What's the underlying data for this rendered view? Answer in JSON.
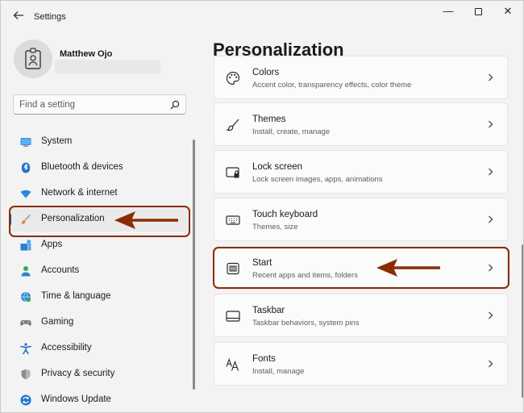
{
  "app": {
    "title": "Settings",
    "window_controls": {
      "minimize": "—",
      "close": "✕"
    }
  },
  "profile": {
    "name": "Matthew Ojo"
  },
  "search": {
    "placeholder": "Find a setting"
  },
  "nav": {
    "items": [
      {
        "label": "System",
        "icon": "monitor-icon"
      },
      {
        "label": "Bluetooth & devices",
        "icon": "bluetooth-icon"
      },
      {
        "label": "Network & internet",
        "icon": "wifi-icon"
      },
      {
        "label": "Personalization",
        "icon": "brush-icon",
        "active": true
      },
      {
        "label": "Apps",
        "icon": "apps-icon"
      },
      {
        "label": "Accounts",
        "icon": "person-icon"
      },
      {
        "label": "Time & language",
        "icon": "globe-icon"
      },
      {
        "label": "Gaming",
        "icon": "controller-icon"
      },
      {
        "label": "Accessibility",
        "icon": "accessibility-icon"
      },
      {
        "label": "Privacy & security",
        "icon": "shield-icon"
      },
      {
        "label": "Windows Update",
        "icon": "update-icon"
      }
    ]
  },
  "main": {
    "title": "Personalization",
    "cards": [
      {
        "title": "Colors",
        "subtitle": "Accent color, transparency effects, color theme",
        "icon": "palette-icon"
      },
      {
        "title": "Themes",
        "subtitle": "Install, create, manage",
        "icon": "brush-icon"
      },
      {
        "title": "Lock screen",
        "subtitle": "Lock screen images, apps, animations",
        "icon": "lock-screen-icon"
      },
      {
        "title": "Touch keyboard",
        "subtitle": "Themes, size",
        "icon": "keyboard-icon"
      },
      {
        "title": "Start",
        "subtitle": "Recent apps and items, folders",
        "icon": "start-icon"
      },
      {
        "title": "Taskbar",
        "subtitle": "Taskbar behaviors, system pins",
        "icon": "taskbar-icon"
      },
      {
        "title": "Fonts",
        "subtitle": "Install, manage",
        "icon": "fonts-icon"
      }
    ]
  },
  "colors": {
    "accent": "#0067c0",
    "annotation": "#8b2c07"
  }
}
